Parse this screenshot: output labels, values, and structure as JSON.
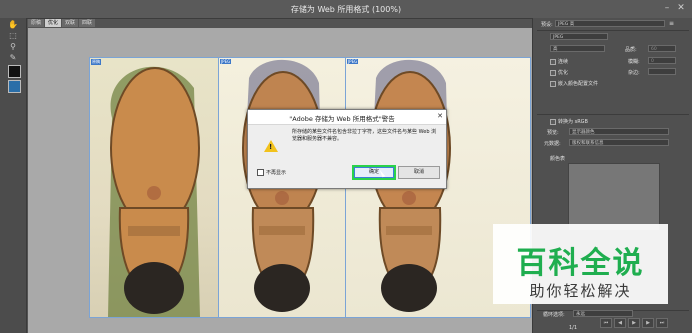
{
  "window": {
    "title": "存储为 Web 所用格式 (100%)",
    "close_glyph": "✕",
    "minimize_glyph": "–"
  },
  "tabs": [
    {
      "label": "原稿"
    },
    {
      "label": "优化"
    },
    {
      "label": "双联"
    },
    {
      "label": "四联"
    }
  ],
  "panes": [
    {
      "label": "原稿"
    },
    {
      "label": "JPEG"
    },
    {
      "label": "JPEG"
    }
  ],
  "dialog": {
    "title": "\"Adobe 存储为 Web 所用格式\"警告",
    "close_glyph": "✕",
    "message": "所存储的某些文件名包含非拉丁字符，这些文件名与某些 Web 浏览器和服务器不兼容。",
    "checkbox_label": "不再显示",
    "ok_label": "确定",
    "cancel_label": "取消"
  },
  "right_panel": {
    "preset_label": "预设:",
    "preset_value": "JPEG 高",
    "format_value": "JPEG",
    "quality_level_value": "高",
    "quality_label": "品质:",
    "quality_value": "60",
    "blur_label": "模糊:",
    "blur_value": "0",
    "matte_label": "杂边:",
    "progressive_label": "连续",
    "optimized_label": "优化",
    "embed_profile_label": "嵌入颜色配置文件",
    "convert_srgb_label": "转换为 sRGB",
    "preview_label": "预览:",
    "preview_value": "显示器颜色",
    "metadata_label": "元数据:",
    "metadata_value": "版权和联系信息",
    "color_table_label": "颜色表",
    "loop_label": "循环选项:",
    "loop_value": "永远",
    "frame_counter": "1/1"
  },
  "watermark": {
    "title": "百科全说",
    "subtitle": "助你轻松解决"
  },
  "colors": {
    "ok_highlight": "#2ad24a",
    "watermark_green": "#1fae4f",
    "pane_border": "#7ba4d6",
    "warning_yellow": "#f2c21c"
  }
}
